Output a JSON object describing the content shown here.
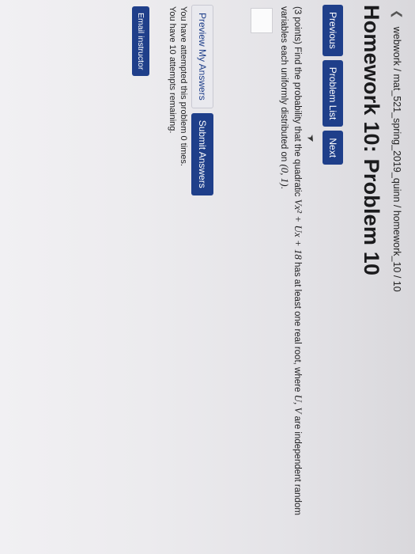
{
  "breadcrumb": {
    "back_icon": "chevron-left-icon",
    "path": "webwork / mat_521_spring_2019_quinn / homework_10 / 10"
  },
  "title": "Homework 10: Problem 10",
  "nav": {
    "previous": "Previous",
    "problem_list": "Problem List",
    "next": "Next"
  },
  "problem": {
    "text_prefix": "(3 points) Find the probability that the quadratic ",
    "expression": "Vx² + Ux + 18",
    "text_mid": " has at least one real root, where ",
    "vars": "U, V",
    "text_suffix": " are independent random variables each uniformly distributed on ",
    "interval": "(0, 1)",
    "end": "."
  },
  "answer": {
    "value": ""
  },
  "buttons": {
    "preview": "Preview My Answers",
    "submit": "Submit Answers",
    "email": "Email instructor"
  },
  "status": {
    "attempted": "You have attempted this problem 0 times.",
    "remaining": "You have 10 attempts remaining."
  },
  "colors": {
    "button_blue": "#1f3f8a"
  }
}
